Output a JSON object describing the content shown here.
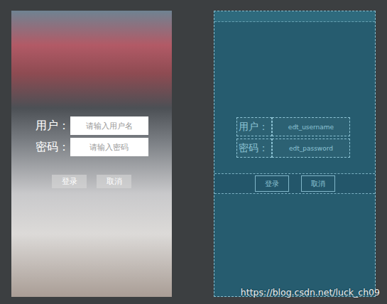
{
  "fields": [
    {
      "label": "用户：",
      "placeholder": "请输入用户名",
      "blueprint_id": "edt_username"
    },
    {
      "label": "密码：",
      "placeholder": "请输入密码",
      "blueprint_id": "edt_password"
    }
  ],
  "buttons": [
    "登录",
    "取消"
  ],
  "watermark": "https://blog.csdn.net/luck_ch09"
}
